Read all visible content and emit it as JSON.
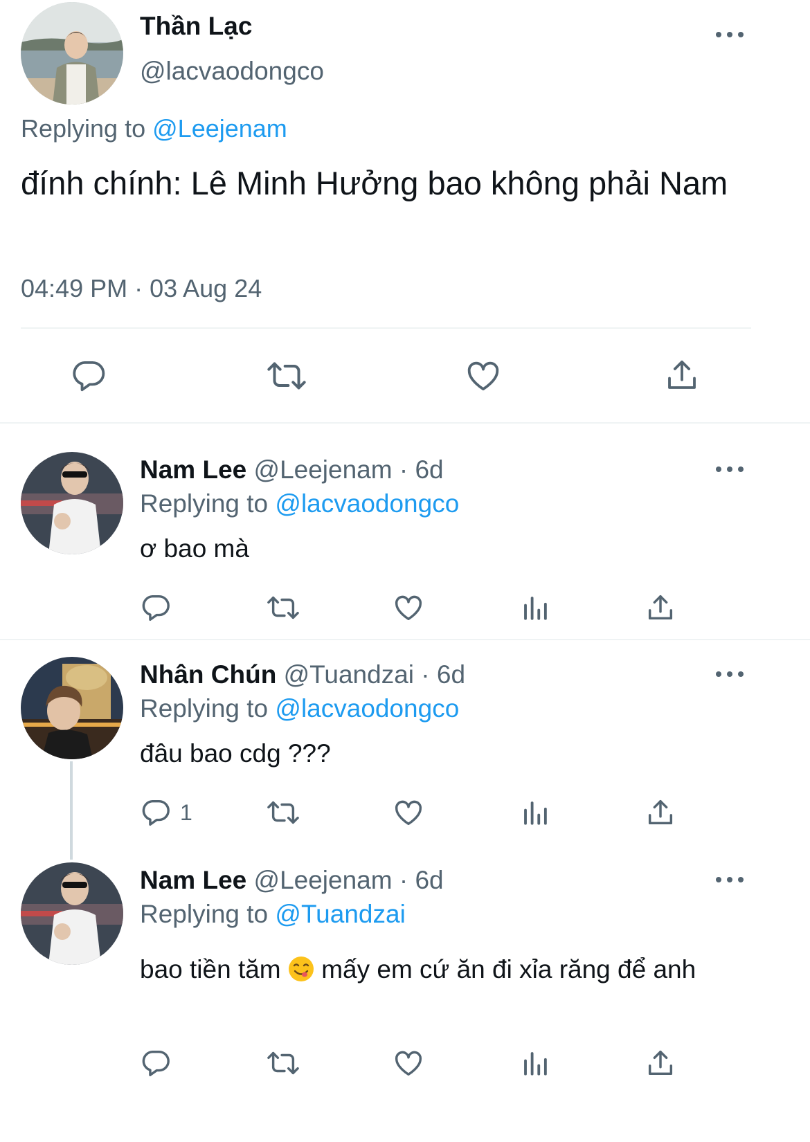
{
  "main_tweet": {
    "display_name": "Thần Lạc",
    "handle": "@lacvaodongco",
    "replying_prefix": "Replying to",
    "replying_to": "@Leejenam",
    "text": "đính chính: Lê Minh Hưởng bao không phải Nam",
    "timestamp": "04:49 PM · 03 Aug 24"
  },
  "replies": [
    {
      "display_name": "Nam Lee",
      "meta": "@Leejenam · 6d",
      "replying_prefix": "Replying to",
      "replying_to": "@lacvaodongco",
      "text": "ơ bao mà",
      "reply_count": ""
    },
    {
      "display_name": "Nhân Chún",
      "meta": "@Tuandzai · 6d",
      "replying_prefix": "Replying to",
      "replying_to": "@lacvaodongco",
      "text": "đâu bao cdg ???",
      "reply_count": "1"
    },
    {
      "display_name": "Nam Lee",
      "meta": "@Leejenam · 6d",
      "replying_prefix": "Replying to",
      "replying_to": "@Tuandzai",
      "text_before_emoji": "bao tiền tăm",
      "text_after_emoji": "mấy em cứ ăn đi xỉa răng để anh",
      "reply_count": ""
    }
  ],
  "icons": {
    "reply": "reply-icon",
    "retweet": "retweet-icon",
    "like": "like-icon",
    "views": "views-icon",
    "share": "share-icon",
    "more": "more-icon",
    "emoji": "yum-emoji-icon"
  },
  "colors": {
    "link": "#1d9bf0",
    "muted": "#536471",
    "text": "#0f1419"
  }
}
